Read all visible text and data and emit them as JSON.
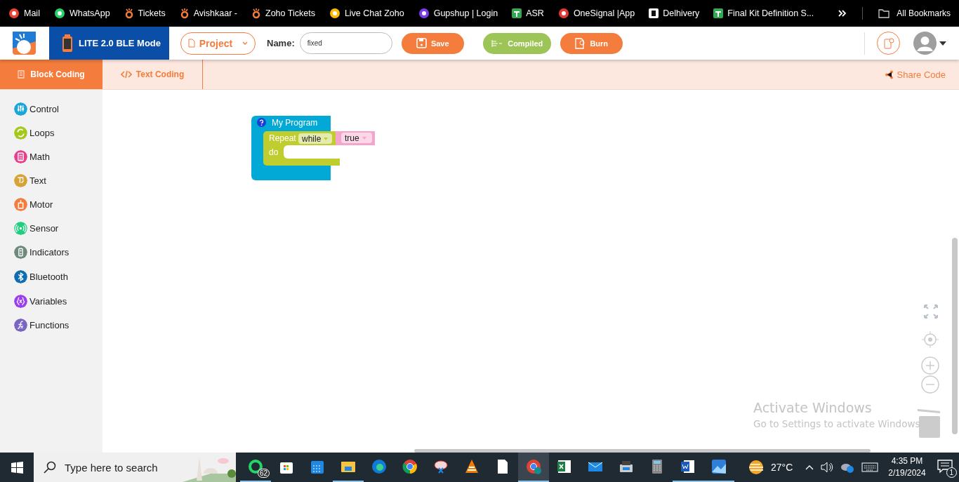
{
  "bookmarks": [
    {
      "label": "Mail"
    },
    {
      "label": "WhatsApp"
    },
    {
      "label": "Tickets"
    },
    {
      "label": "Avishkaar -"
    },
    {
      "label": "Zoho Tickets"
    },
    {
      "label": "Live Chat Zoho"
    },
    {
      "label": "Gupshup | Login"
    },
    {
      "label": "ASR"
    },
    {
      "label": "OneSignal |App"
    },
    {
      "label": "Delhivery"
    },
    {
      "label": "Final Kit Definition S..."
    }
  ],
  "all_bookmarks": "All Bookmarks",
  "header": {
    "device": "LITE 2.0 BLE Mode",
    "project_button": "Project",
    "name_label": "Name:",
    "name_value": "fixed",
    "save": "Save",
    "compiled": "Compiled",
    "burn": "Burn"
  },
  "tabs": [
    {
      "label": "Block Coding",
      "selected": true
    },
    {
      "label": "Text Coding",
      "selected": false
    }
  ],
  "share_code": "Share Code",
  "categories": [
    {
      "label": "Control",
      "color": "#1ba6d9"
    },
    {
      "label": "Loops",
      "color": "#a5c81e"
    },
    {
      "label": "Math",
      "color": "#e83e8c"
    },
    {
      "label": "Text",
      "color": "#d6a336"
    },
    {
      "label": "Motor",
      "color": "#f47c3c"
    },
    {
      "label": "Sensor",
      "color": "#1fcf7e"
    },
    {
      "label": "Indicators",
      "color": "#6d8a7c"
    },
    {
      "label": "Bluetooth",
      "color": "#0e6db3"
    },
    {
      "label": "Variables",
      "color": "#9b3df0"
    },
    {
      "label": "Functions",
      "color": "#7a64c4"
    }
  ],
  "program": {
    "title": "My Program",
    "repeat": "Repeat",
    "mode": "while",
    "condition": "true",
    "do": "do"
  },
  "activation": {
    "title": "Activate Windows",
    "message": "Go to Settings to activate Windows."
  },
  "taskbar": {
    "search_placeholder": "Type here to search",
    "apps": [
      {
        "open": true,
        "selected": false,
        "badge": "62"
      },
      {
        "open": false,
        "selected": false
      },
      {
        "open": false,
        "selected": false
      },
      {
        "open": true,
        "selected": false
      },
      {
        "open": false,
        "selected": false
      },
      {
        "open": false,
        "selected": false
      },
      {
        "open": false,
        "selected": false
      },
      {
        "open": false,
        "selected": false
      },
      {
        "open": false,
        "selected": false
      },
      {
        "open": true,
        "selected": true
      },
      {
        "open": false,
        "selected": false
      },
      {
        "open": false,
        "selected": false
      },
      {
        "open": false,
        "selected": false
      },
      {
        "open": false,
        "selected": false
      },
      {
        "open": true,
        "selected": false
      },
      {
        "open": true,
        "selected": false
      }
    ],
    "temperature": "27°C",
    "time": "4:35 PM",
    "date": "2/19/2024",
    "notifications": "1"
  }
}
